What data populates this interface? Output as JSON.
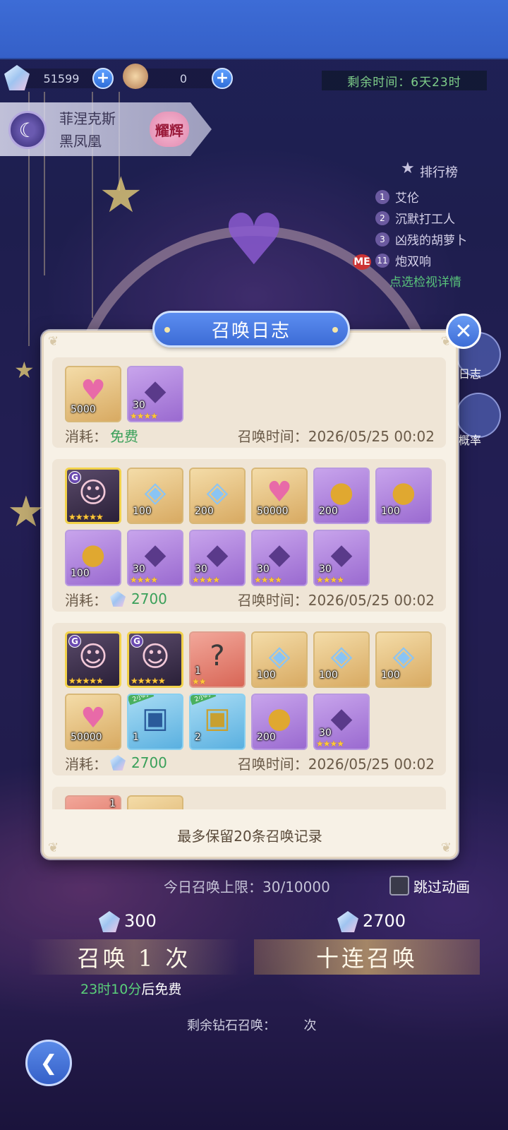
{
  "top": {
    "diamond_count": "51599",
    "token_count": "0",
    "remaining_time_label": "剩余时间：",
    "remaining_time_value": "6天23时"
  },
  "character": {
    "name_line1": "菲涅克斯",
    "name_line2": "黑凤凰",
    "badge": "耀辉"
  },
  "ranking": {
    "title": "排行榜",
    "entries": [
      {
        "rank": "1",
        "name": "艾伦"
      },
      {
        "rank": "2",
        "name": "沉默打工人"
      },
      {
        "rank": "3",
        "name": "凶残的胡萝卜"
      },
      {
        "rank": "11",
        "name": "炮双响"
      }
    ],
    "me_label": "ME",
    "detail_link": "点选检视详情"
  },
  "side_buttons": {
    "log_label": "日志",
    "rate_label": "概率"
  },
  "dialog": {
    "title": "召唤日志",
    "footer": "最多保留20条召唤记录",
    "cost_label": "消耗：",
    "time_label": "召唤时间：",
    "entries": [
      {
        "cost": "免费",
        "time": "2026/05/25 00:02",
        "items": [
          {
            "kind": "gold",
            "icon": "heart-chest-icon",
            "glyph": "♥",
            "qty": "5000"
          },
          {
            "kind": "purple",
            "icon": "purple-crystal-icon",
            "glyph": "◆",
            "qty": "30",
            "stars": "★★★★"
          }
        ]
      },
      {
        "cost": "2700",
        "time": "2026/05/25 00:02",
        "items": [
          {
            "kind": "char",
            "icon": "character-portrait-icon",
            "glyph": "☺",
            "stars": "★★★★★"
          },
          {
            "kind": "gold",
            "icon": "diamond-icon",
            "glyph": "◈",
            "qty": "100"
          },
          {
            "kind": "gold",
            "icon": "diamond-icon",
            "glyph": "◈",
            "qty": "200"
          },
          {
            "kind": "gold",
            "icon": "heart-chest-icon",
            "glyph": "♥",
            "qty": "50000"
          },
          {
            "kind": "purple",
            "icon": "golden-egg-icon",
            "glyph": "●",
            "qty": "200"
          },
          {
            "kind": "purple",
            "icon": "golden-egg-icon",
            "glyph": "●",
            "qty": "100"
          },
          {
            "kind": "purple",
            "icon": "golden-egg-icon",
            "glyph": "●",
            "qty": "100"
          },
          {
            "kind": "purple",
            "icon": "purple-crystal-icon",
            "glyph": "◆",
            "qty": "30",
            "stars": "★★★★"
          },
          {
            "kind": "purple",
            "icon": "purple-crystal-icon",
            "glyph": "◆",
            "qty": "30",
            "stars": "★★★★"
          },
          {
            "kind": "purple",
            "icon": "purple-crystal-icon",
            "glyph": "◆",
            "qty": "30",
            "stars": "★★★★"
          },
          {
            "kind": "purple",
            "icon": "purple-crystal-icon",
            "glyph": "◆",
            "qty": "30",
            "stars": "★★★★"
          }
        ]
      },
      {
        "cost": "2700",
        "time": "2026/05/25 00:02",
        "items": [
          {
            "kind": "char",
            "icon": "character-portrait-icon",
            "glyph": "☺",
            "stars": "★★★★★"
          },
          {
            "kind": "char",
            "icon": "character-portrait-icon",
            "glyph": "☺",
            "stars": "★★★★★"
          },
          {
            "kind": "red",
            "icon": "mystery-box-icon",
            "glyph": "?",
            "qty": "1",
            "stars": "★★"
          },
          {
            "kind": "gold",
            "icon": "diamond-icon",
            "glyph": "◈",
            "qty": "100"
          },
          {
            "kind": "gold",
            "icon": "diamond-icon",
            "glyph": "◈",
            "qty": "100"
          },
          {
            "kind": "gold",
            "icon": "diamond-icon",
            "glyph": "◈",
            "qty": "100"
          },
          {
            "kind": "gold",
            "icon": "heart-chest-icon",
            "glyph": "♥",
            "qty": "50000"
          },
          {
            "kind": "blue",
            "icon": "treasure-chest-icon",
            "glyph": "▣",
            "qty": "1",
            "ribbon": "2小时"
          },
          {
            "kind": "blue",
            "icon": "gold-chest-icon",
            "glyph": "▣",
            "qty": "2",
            "ribbon": "2小时"
          },
          {
            "kind": "purple",
            "icon": "golden-egg-icon",
            "glyph": "●",
            "qty": "200"
          },
          {
            "kind": "purple",
            "icon": "purple-crystal-icon",
            "glyph": "◆",
            "qty": "30",
            "stars": "★★★★"
          }
        ]
      },
      {
        "items": [
          {
            "kind": "red",
            "icon": "card-item-icon",
            "glyph": "▤",
            "qty": "1"
          },
          {
            "kind": "gold",
            "icon": "diamond-icon",
            "glyph": "◈"
          }
        ]
      }
    ]
  },
  "bottom": {
    "daily_limit_label": "今日召唤上限：",
    "daily_limit_value": "30/10000",
    "skip_label": "跳过动画",
    "cost_single": "300",
    "cost_ten": "2700",
    "summon_once": "召唤 1 次",
    "summon_ten": "十连召唤",
    "free_timer": "23时10分",
    "free_suffix": "后免费",
    "remain_label": "剩余钻石召唤：",
    "remain_suffix": "次"
  },
  "colors": {
    "dialog_bg": "#f7f1e6",
    "title_blue": "#3d6cd6",
    "free_green": "#3aa05a"
  }
}
